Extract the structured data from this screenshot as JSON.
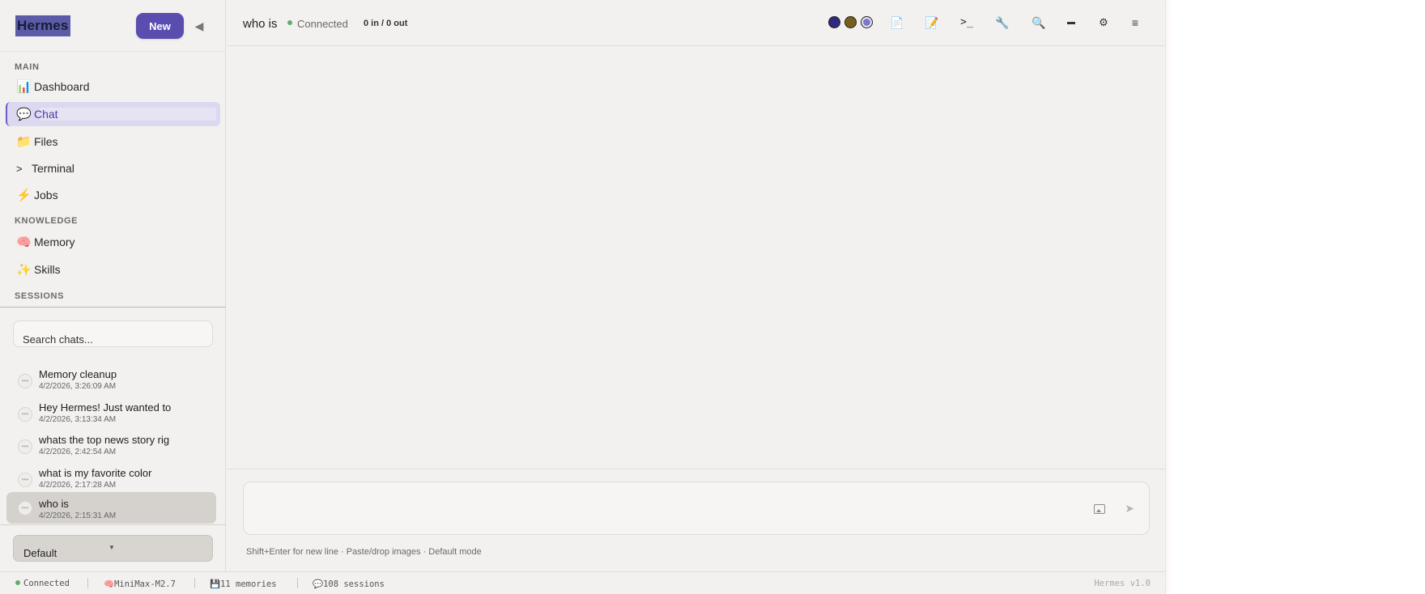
{
  "brand": "Hermes",
  "new_button": "New",
  "sections": {
    "main": "MAIN",
    "knowledge": "KNOWLEDGE",
    "sessions": "SESSIONS"
  },
  "nav": {
    "dashboard": "Dashboard",
    "chat": "Chat",
    "files": "Files",
    "terminal": "Terminal",
    "jobs": "Jobs",
    "memory": "Memory",
    "skills": "Skills"
  },
  "search": {
    "placeholder": "Search chats..."
  },
  "sessions": [
    {
      "title": "Memory cleanup",
      "time": "4/2/2026, 3:26:09 AM"
    },
    {
      "title": "Hey Hermes! Just wanted to",
      "time": "4/2/2026, 3:13:34 AM"
    },
    {
      "title": "whats the top news story rig",
      "time": "4/2/2026, 2:42:54 AM"
    },
    {
      "title": "what is my favorite color",
      "time": "4/2/2026, 2:17:28 AM"
    },
    {
      "title": "who is",
      "time": "4/2/2026, 2:15:31 AM"
    }
  ],
  "profile": {
    "selected": "Default"
  },
  "header": {
    "title": "who is",
    "status": "Connected",
    "tokens": "0 in / 0 out"
  },
  "composer": {
    "placeholder": "",
    "hint": "Shift+Enter for new line · Paste/drop images · Default mode"
  },
  "statusbar": {
    "connection": "Connected",
    "model": "MiniMax-M2.7",
    "memories": "11 memories",
    "sessions": "108 sessions",
    "version": "Hermes v1.0"
  },
  "colors": {
    "accent": "#5a4db0",
    "active_nav_bg": "#dcd8f0",
    "connected": "#5fae6a"
  },
  "icons": {
    "dashboard": "bar-chart-icon",
    "chat": "speech-bubble-icon",
    "files": "folder-icon",
    "terminal": "prompt-icon",
    "jobs": "lightning-icon",
    "memory": "brain-icon",
    "skills": "sparkles-icon"
  }
}
